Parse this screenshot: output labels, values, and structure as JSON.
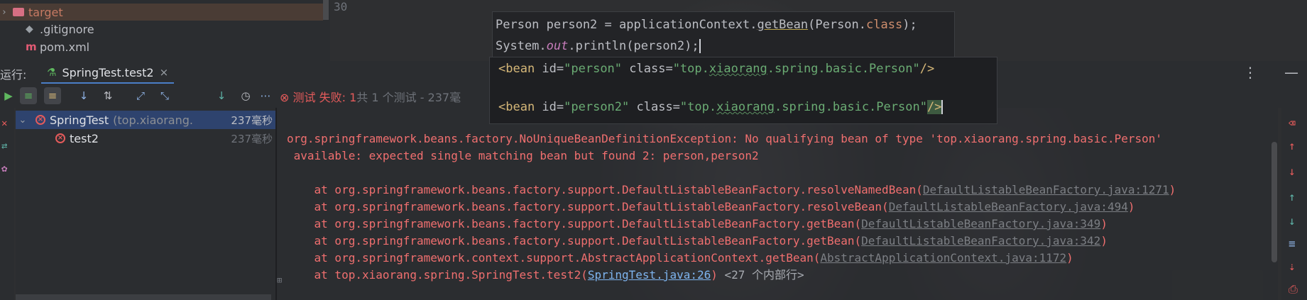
{
  "project": {
    "items": [
      {
        "label": "target",
        "icon": "folder-icon"
      },
      {
        "label": ".gitignore",
        "icon": "git-icon"
      },
      {
        "label": "pom.xml",
        "icon": "maven-icon"
      }
    ],
    "line_number": "30"
  },
  "editor": {
    "line1": {
      "a": "Person person2 = applicationContext.",
      "b": "getBean",
      "c": "(Person.",
      "d": "class",
      "e": ");"
    },
    "line2": {
      "a": "System.",
      "b": "out",
      "c": ".println(person2);"
    }
  },
  "xml": {
    "line1": {
      "tag": "<bean",
      "id_attr": " id=",
      "id_val": "\"person\"",
      "class_attr": " class=",
      "class_val_a": "\"top.",
      "class_val_b": "xiaorang",
      "class_val_c": ".spring.basic.Person\"",
      "end": "/>"
    },
    "line2": {
      "tag": "<bean",
      "id_attr": " id=",
      "id_val": "\"person2\"",
      "class_attr": " class=",
      "class_val_a": "\"top.",
      "class_val_b": "xiaorang",
      "class_val_c": ".spring.basic.Person\"",
      "end": "/>"
    }
  },
  "run": {
    "label": "运行:",
    "tab_label": "SpringTest.test2",
    "status": {
      "fail_prefix": "测试 失败: 1",
      "rest": "共 1 个测试 - 237毫"
    }
  },
  "tests": [
    {
      "name": "SpringTest",
      "pkg": "(top.xiaorang.",
      "time": "237毫秒"
    },
    {
      "name": "test2",
      "pkg": "",
      "time": "237毫秒"
    }
  ],
  "console": {
    "exception_line1": "org.springframework.beans.factory.NoUniqueBeanDefinitionException: No qualifying bean of type 'top.xiaorang.spring.basic.Person'",
    "exception_line2": " available: expected single matching bean but found 2: person,person2",
    "stack": [
      {
        "prefix": "    at org.springframework.beans.factory.support.DefaultListableBeanFactory.resolveNamedBean(",
        "link": "DefaultListableBeanFactory.java:1271",
        "suffix": ")"
      },
      {
        "prefix": "    at org.springframework.beans.factory.support.DefaultListableBeanFactory.resolveBean(",
        "link": "DefaultListableBeanFactory.java:494",
        "suffix": ")"
      },
      {
        "prefix": "    at org.springframework.beans.factory.support.DefaultListableBeanFactory.getBean(",
        "link": "DefaultListableBeanFactory.java:349",
        "suffix": ")"
      },
      {
        "prefix": "    at org.springframework.beans.factory.support.DefaultListableBeanFactory.getBean(",
        "link": "DefaultListableBeanFactory.java:342",
        "suffix": ")"
      },
      {
        "prefix": "    at org.springframework.context.support.AbstractApplicationContext.getBean(",
        "link": "AbstractApplicationContext.java:1172",
        "suffix": ")"
      },
      {
        "prefix": "    at top.xiaorang.spring.SpringTest.test2(",
        "link": "SpringTest.java:26",
        "suffix": ") ",
        "extra": "<27 个内部行>"
      }
    ]
  },
  "colors": {
    "error": "#f06f6f",
    "link": "#7eb4ef",
    "accent": "#4a7ec7"
  }
}
